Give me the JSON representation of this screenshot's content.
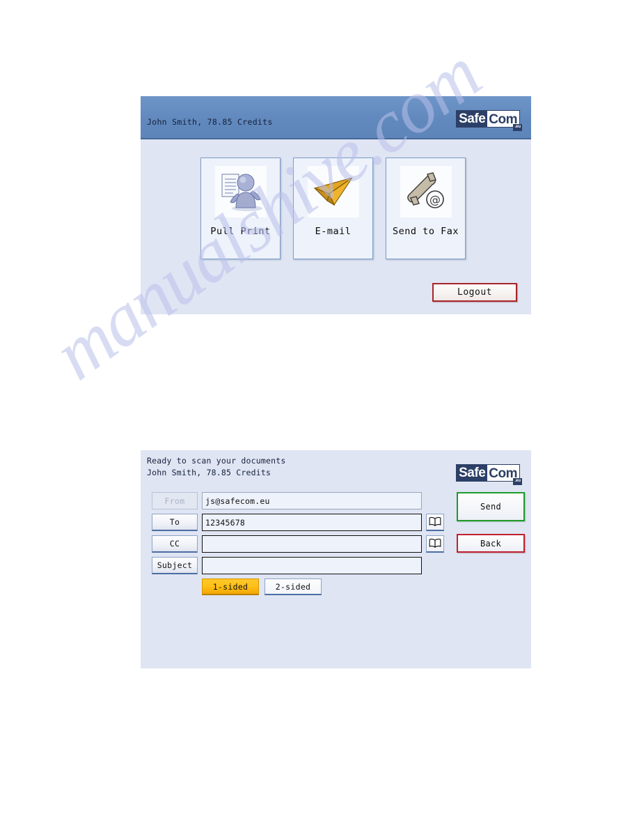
{
  "watermark": {
    "text": "manualshive.com"
  },
  "panel_home": {
    "header": {
      "user_line": "John Smith, 78.85 Credits",
      "logo": {
        "part1": "Safe",
        "part2": "Com",
        "tld": ".eu"
      }
    },
    "tiles": [
      {
        "label": "Pull Print",
        "icon": "person-with-document-icon"
      },
      {
        "label": "E-mail",
        "icon": "paper-plane-icon"
      },
      {
        "label": "Send to Fax",
        "icon": "fax-phone-at-icon"
      }
    ],
    "logout_label": "Logout"
  },
  "panel_email": {
    "status_line": "Ready to scan your documents",
    "user_line": "John Smith, 78.85 Credits",
    "logo": {
      "part1": "Safe",
      "part2": "Com",
      "tld": ".eu"
    },
    "fields": [
      {
        "label": "From",
        "value": "js@safecom.eu",
        "placeholder": "",
        "disabled": true,
        "has_book": false
      },
      {
        "label": "To",
        "value": "12345678",
        "placeholder": "",
        "disabled": false,
        "has_book": true
      },
      {
        "label": "CC",
        "value": "",
        "placeholder": "",
        "disabled": false,
        "has_book": true
      },
      {
        "label": "Subject",
        "value": "",
        "placeholder": "",
        "disabled": false,
        "has_book": false
      }
    ],
    "duplex": {
      "options": [
        {
          "label": "1-sided",
          "selected": true
        },
        {
          "label": "2-sided",
          "selected": false
        }
      ]
    },
    "send_label": "Send",
    "back_label": "Back"
  },
  "colors": {
    "header_blue": "#6189bd",
    "panel_body": "#dfe5f3",
    "logo_navy": "#2c3f66",
    "accent_orange": "#ffc119",
    "send_green": "#1f9b2a",
    "back_red": "#c02030",
    "logout_red": "#a8252a"
  }
}
